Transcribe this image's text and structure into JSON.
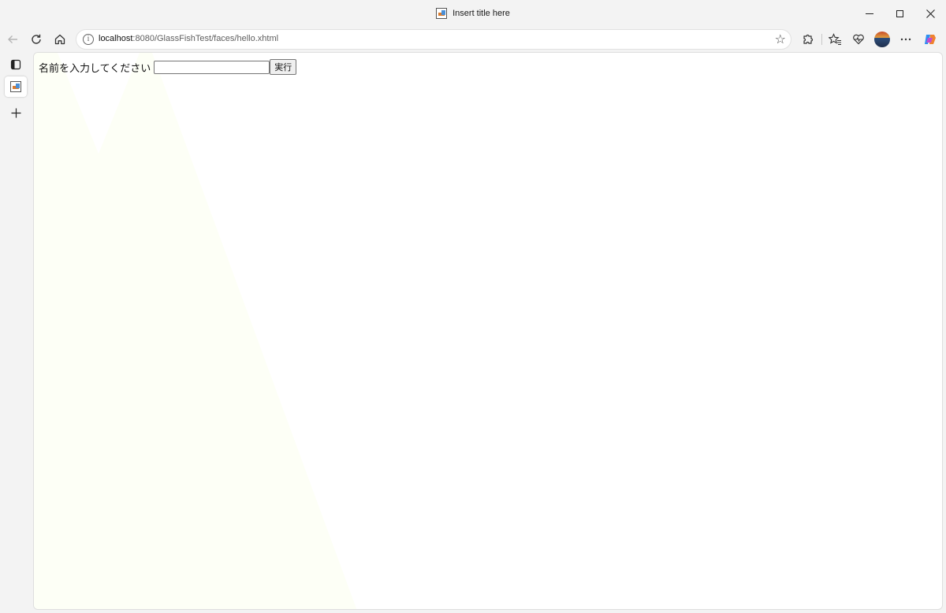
{
  "window": {
    "title": "Insert title here"
  },
  "navbar": {
    "url_host": "localhost",
    "url_rest": ":8080/GlassFishTest/faces/hello.xhtml"
  },
  "page": {
    "label": "名前を入力してください",
    "input_value": "",
    "submit_label": "実行"
  },
  "icons": {
    "back": "back-arrow-icon",
    "refresh": "refresh-icon",
    "home": "home-icon",
    "info": "site-info-icon",
    "favorite": "star-icon",
    "extensions": "puzzle-icon",
    "favorites": "favorites-icon",
    "performance": "heart-pulse-icon",
    "profile": "avatar",
    "menu": "more-icon",
    "copilot": "copilot-icon"
  },
  "colors": {
    "chrome_bg": "#f3f3f3",
    "page_bg": "#ffffff",
    "accent": "#0f6cbd"
  }
}
